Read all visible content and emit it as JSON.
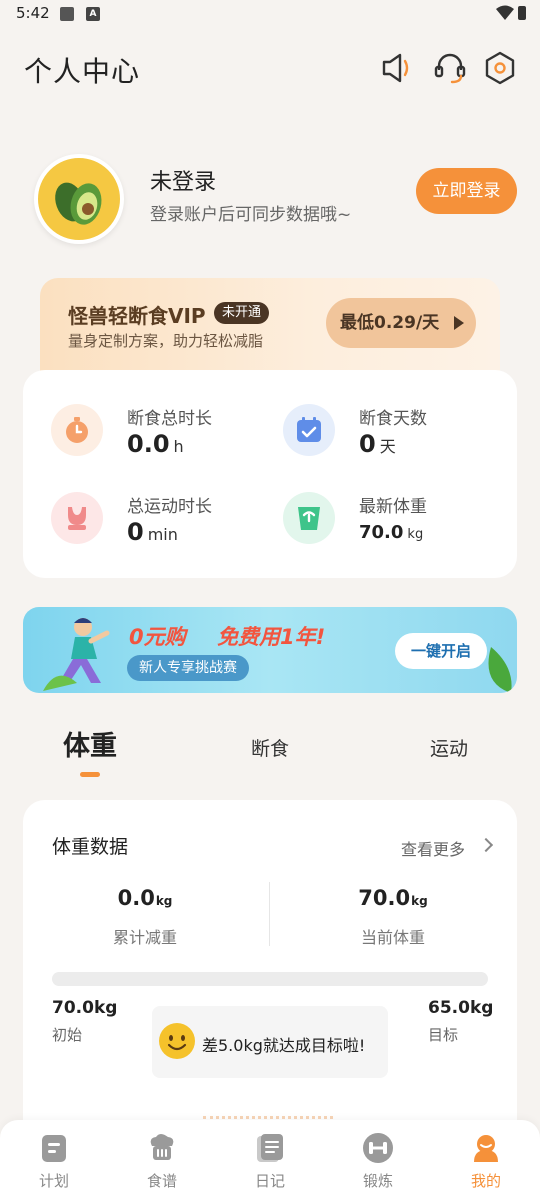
{
  "status_bar": {
    "time": "5:42"
  },
  "header": {
    "title": "个人中心"
  },
  "profile": {
    "name": "未登录",
    "subtitle": "登录账户后可同步数据哦~",
    "login_button": "立即登录"
  },
  "vip": {
    "title": "怪兽轻断食VIP",
    "badge": "未开通",
    "subtitle": "量身定制方案，助力轻松减脂",
    "price_button": "最低0.29/天"
  },
  "stats": [
    {
      "label": "断食总时长",
      "value": "0.0",
      "unit": "h",
      "icon": "timer-icon",
      "color": "#f5a06a",
      "bg": "#fdeee3"
    },
    {
      "label": "断食天数",
      "value": "0",
      "unit": "天",
      "icon": "calendar-icon",
      "color": "#5f8de8",
      "bg": "#e6eefb"
    },
    {
      "label": "总运动时长",
      "value": "0",
      "unit": "min",
      "icon": "sports-bra-icon",
      "color": "#f08a8a",
      "bg": "#fde7e7"
    },
    {
      "label": "最新体重",
      "value": "70.0",
      "unit": "kg",
      "icon": "scale-icon",
      "color": "#3ec48a",
      "bg": "#e2f6ec"
    }
  ],
  "banner": {
    "title_part1": "0元购",
    "title_part2": "免费用1年!",
    "subtitle": "新人专享挑战赛",
    "button": "一键开启"
  },
  "tabs": [
    {
      "label": "体重",
      "active": true
    },
    {
      "label": "断食",
      "active": false
    },
    {
      "label": "运动",
      "active": false
    }
  ],
  "weight": {
    "title": "体重数据",
    "more": "查看更多",
    "lost_value": "0.0",
    "lost_unit": "kg",
    "lost_label": "累计减重",
    "current_value": "70.0",
    "current_unit": "kg",
    "current_label": "当前体重",
    "progress": 0,
    "start_value": "70.0kg",
    "start_label": "初始",
    "goal_value": "65.0kg",
    "goal_label": "目标",
    "tip": "差5.0kg就达成目标啦!"
  },
  "nav": [
    {
      "label": "计划",
      "icon": "plan-icon",
      "active": false
    },
    {
      "label": "食谱",
      "icon": "recipe-icon",
      "active": false
    },
    {
      "label": "日记",
      "icon": "diary-icon",
      "active": false
    },
    {
      "label": "锻炼",
      "icon": "dumbbell-icon",
      "active": false
    },
    {
      "label": "我的",
      "icon": "profile-icon",
      "active": true
    }
  ],
  "colors": {
    "accent": "#f5913a",
    "background": "#f6f3f0"
  }
}
